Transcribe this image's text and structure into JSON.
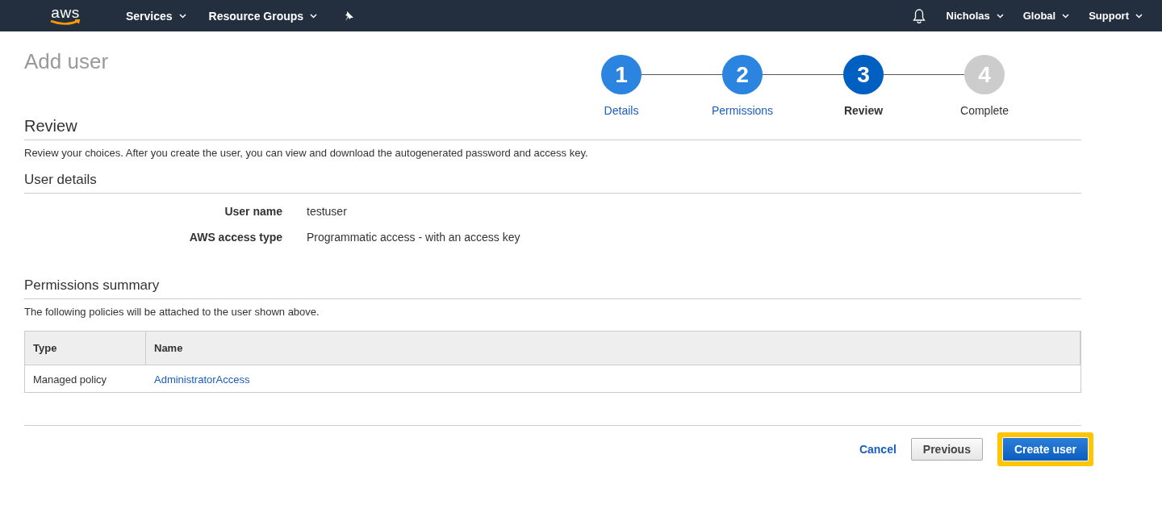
{
  "navbar": {
    "logo": "aws",
    "menus": [
      {
        "label": "Services"
      },
      {
        "label": "Resource Groups"
      }
    ],
    "right_menus": [
      {
        "label": "Nicholas"
      },
      {
        "label": "Global"
      },
      {
        "label": "Support"
      }
    ]
  },
  "page_title": "Add user",
  "steps": [
    {
      "number": "1",
      "label": "Details",
      "kind": "done"
    },
    {
      "number": "2",
      "label": "Permissions",
      "kind": "done"
    },
    {
      "number": "3",
      "label": "Review",
      "kind": "current"
    },
    {
      "number": "4",
      "label": "Complete",
      "kind": "pending"
    }
  ],
  "review": {
    "heading": "Review",
    "description": "Review your choices. After you create the user, you can view and download the autogenerated password and access key."
  },
  "user_details": {
    "heading": "User details",
    "fields": [
      {
        "label": "User name",
        "value": "testuser"
      },
      {
        "label": "AWS access type",
        "value": "Programmatic access - with an access key"
      }
    ]
  },
  "permissions_summary": {
    "heading": "Permissions summary",
    "description": "The following policies will be attached to the user shown above.",
    "table": {
      "columns": [
        "Type",
        "Name"
      ],
      "rows": [
        {
          "type": "Managed policy",
          "name": "AdministratorAccess"
        }
      ]
    }
  },
  "footer": {
    "cancel": "Cancel",
    "previous": "Previous",
    "create": {
      "label": "Create user",
      "highlighted": true
    }
  }
}
